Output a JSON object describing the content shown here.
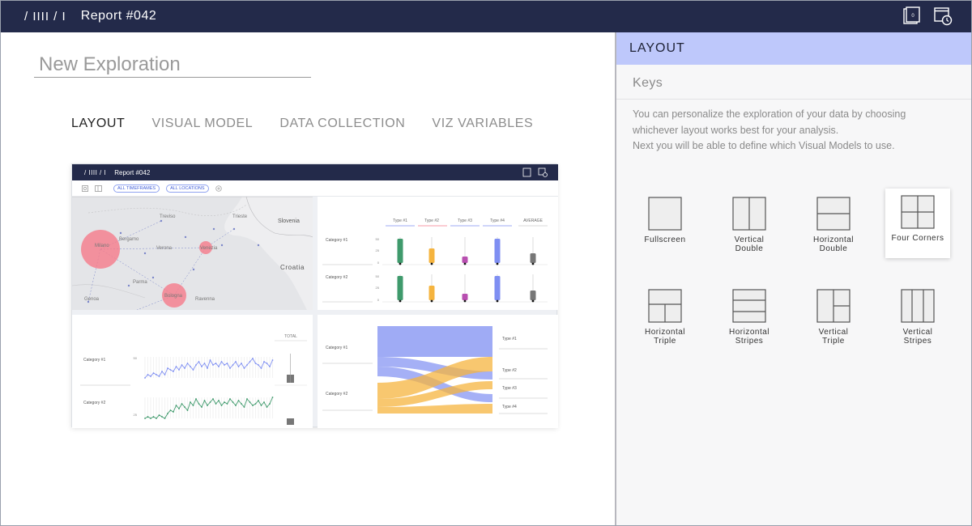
{
  "topbar": {
    "breadcrumb": "/ IIII / I",
    "title": "Report #042",
    "icon_report": "report-icon",
    "icon_history": "history-icon"
  },
  "main": {
    "name_placeholder": "New Exploration",
    "tabs": [
      {
        "label": "LAYOUT",
        "active": true
      },
      {
        "label": "VISUAL MODEL",
        "active": false
      },
      {
        "label": "DATA COLLECTION",
        "active": false
      },
      {
        "label": "VIZ VARIABLES",
        "active": false
      }
    ]
  },
  "preview": {
    "breadcrumb": "/ IIII / I",
    "title": "Report #042",
    "filters": [
      "ALL TIMEFRAMES",
      "ALL LOCATIONS"
    ],
    "map": {
      "country_labels": [
        "Slovenia",
        "Croatia"
      ],
      "city_labels": [
        "Milano",
        "Bergamo",
        "Verona",
        "Venezia",
        "Trieste",
        "Treviso",
        "Parma",
        "Bologna",
        "Ravenna",
        "Genoa"
      ]
    },
    "bar_panel": {
      "types": [
        "Type #1",
        "Type #2",
        "Type #3",
        "Type #4"
      ],
      "average": "AVERAGE",
      "categories": [
        "Category #1",
        "Category #2"
      ],
      "ticks": [
        "50",
        "25",
        "0"
      ]
    },
    "line_panel": {
      "total": "TOTAL",
      "categories": [
        "Category #1",
        "Category #2"
      ],
      "ticks": [
        "50",
        "25"
      ]
    },
    "flow_panel": {
      "categories": [
        "Category #1",
        "Category #2"
      ],
      "types": [
        "Type #1",
        "Type #2",
        "Type #3",
        "Type #4"
      ]
    }
  },
  "sidebar": {
    "header": "LAYOUT",
    "subtitle": "Keys",
    "description": [
      "You can personalize the exploration of your data by choosing",
      "whichever layout works best for your analysis.",
      "Next you will be able to define which Visual Models to use."
    ],
    "layouts": [
      {
        "label": "Fullscreen",
        "icon": "fullscreen-layout-icon",
        "selected": false
      },
      {
        "label": "Vertical\nDouble",
        "icon": "vertical-double-layout-icon",
        "selected": false
      },
      {
        "label": "Horizontal\nDouble",
        "icon": "horizontal-double-layout-icon",
        "selected": false
      },
      {
        "label": "Four Corners",
        "icon": "four-corners-layout-icon",
        "selected": true
      },
      {
        "label": "Horizontal\nTriple",
        "icon": "horizontal-triple-layout-icon",
        "selected": false
      },
      {
        "label": "Horizontal\nStripes",
        "icon": "horizontal-stripes-layout-icon",
        "selected": false
      },
      {
        "label": "Vertical\nTriple",
        "icon": "vertical-triple-layout-icon",
        "selected": false
      },
      {
        "label": "Vertical\nStripes",
        "icon": "vertical-stripes-layout-icon",
        "selected": false
      }
    ]
  },
  "colors": {
    "navy": "#232a4a",
    "accent_light": "#bec8fb",
    "green": "#3f9a6c",
    "yellow": "#f5b43f",
    "purple": "#b84fb0",
    "blue": "#7f8ff2",
    "bubble": "#f57a8a"
  }
}
